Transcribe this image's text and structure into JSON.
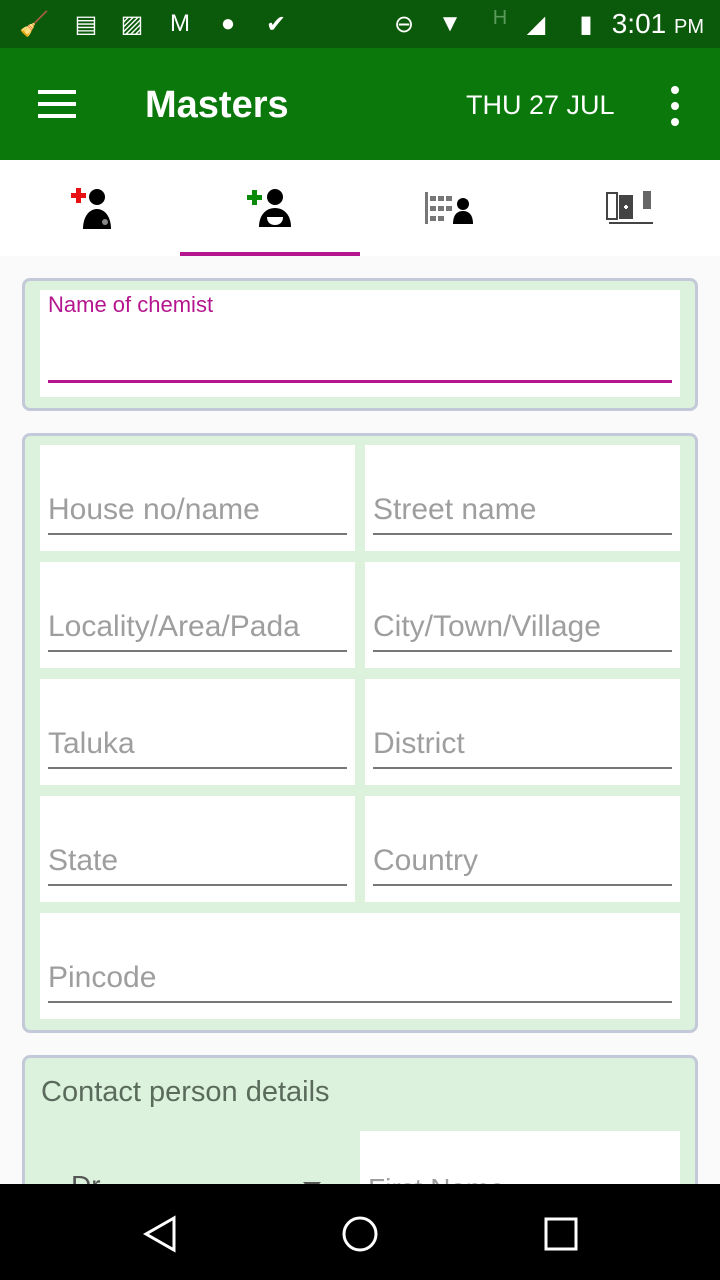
{
  "status_bar": {
    "time": "3:01",
    "ampm": "PM",
    "icons": [
      "cleaner-icon",
      "notes-icon",
      "gallery-icon",
      "gmail-icon",
      "android-icon",
      "check-icon",
      "do-not-disturb-icon",
      "wifi-icon",
      "network-h-icon",
      "signal-icon",
      "battery-charging-icon"
    ]
  },
  "app_bar": {
    "title": "Masters",
    "date": "THU 27 JUL"
  },
  "tabs": [
    {
      "icon": "doctor-icon"
    },
    {
      "icon": "chemist-icon",
      "active": true
    },
    {
      "icon": "stockist-icon"
    },
    {
      "icon": "medicines-icon"
    }
  ],
  "colors": {
    "status": "#0b5a0b",
    "app_bar": "#0a780a",
    "accent": "#b5168f",
    "card": "#dcf2dc"
  },
  "form": {
    "chemist_name_label": "Name of chemist",
    "chemist_name_value": "",
    "address": {
      "house": "House no/name",
      "street": "Street name",
      "locality": "Locality/Area/Pada",
      "city": "City/Town/Village",
      "taluka": "Taluka",
      "district": "District",
      "state": "State",
      "country": "Country",
      "pincode": "Pincode"
    },
    "contact": {
      "title": "Contact person details",
      "salutation": "Dr.",
      "first_name": "First Name"
    }
  }
}
